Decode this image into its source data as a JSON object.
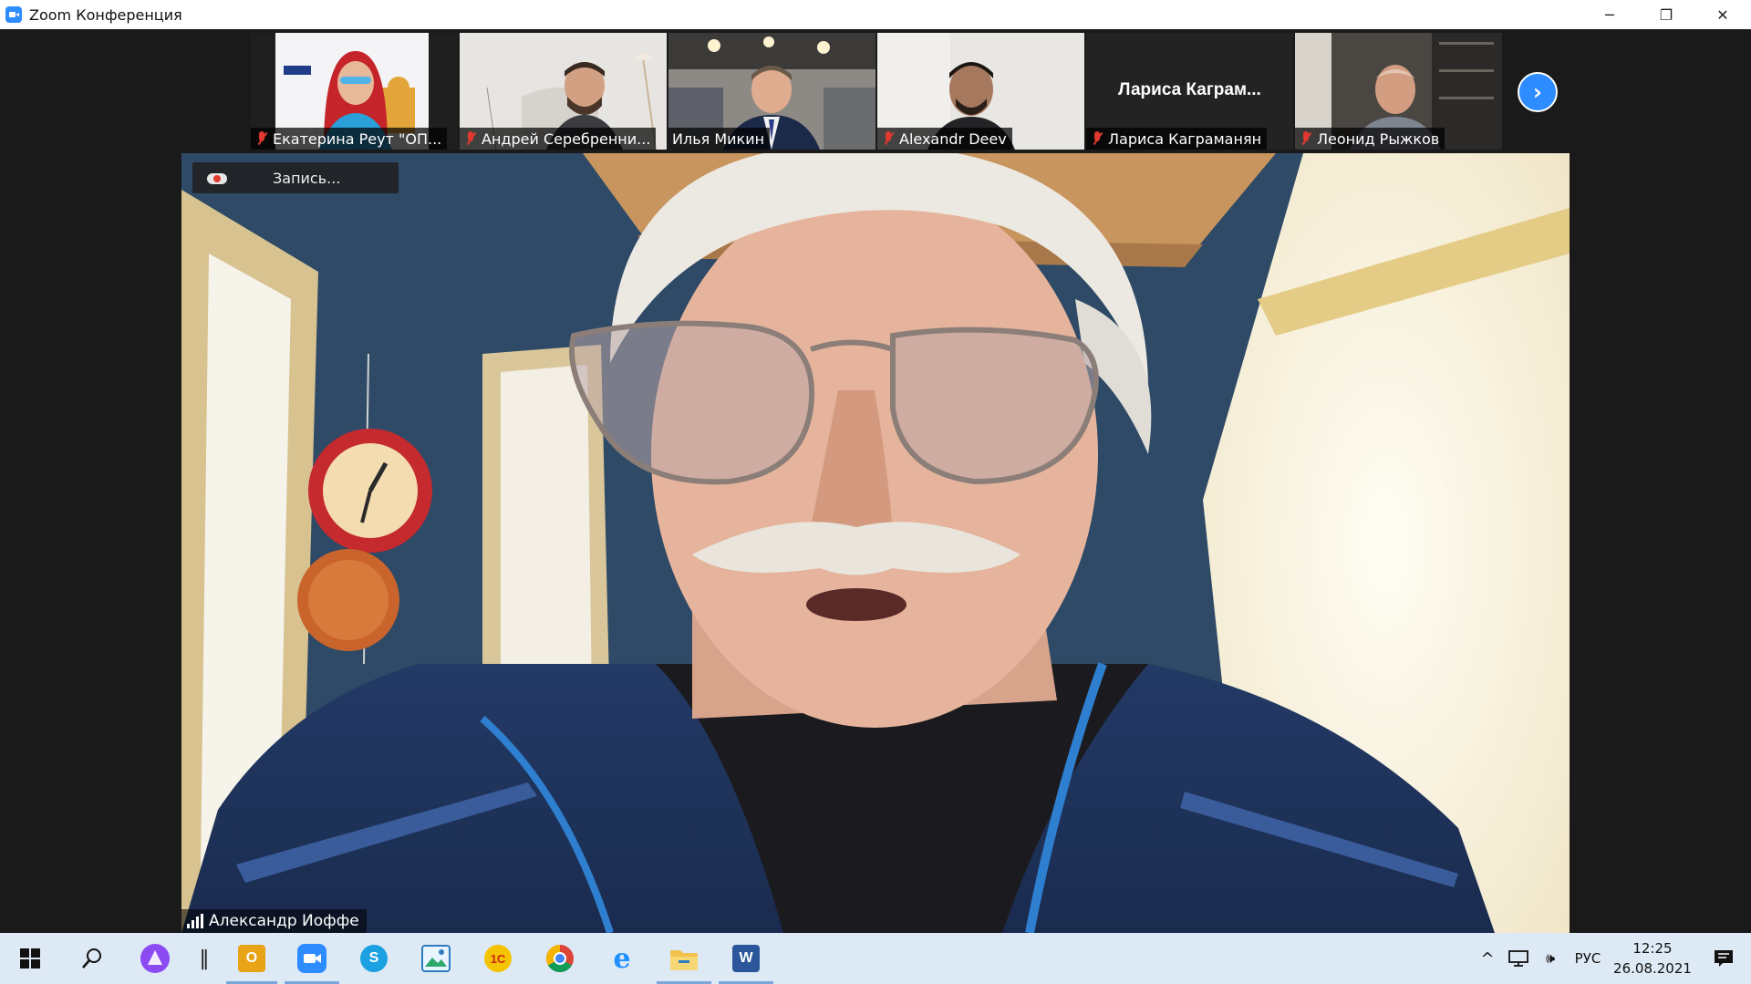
{
  "window": {
    "title": "Zoom Конференция",
    "minimize_glyph": "─",
    "restore_glyph": "❐",
    "close_glyph": "✕"
  },
  "participants": [
    {
      "name": "Екатерина Реут \"ОП...",
      "muted": true,
      "kind": "video-woman"
    },
    {
      "name": "Андрей Серебренни...",
      "muted": true,
      "kind": "video-man-light"
    },
    {
      "name": "Илья Микин",
      "muted": false,
      "kind": "video-man-office"
    },
    {
      "name": "Alexandr Deev",
      "muted": true,
      "kind": "video-man-plain"
    },
    {
      "name": "Лариса Каграманян",
      "muted": true,
      "kind": "name-only",
      "display_name": "Лариса  Каграм..."
    },
    {
      "name": "Леонид Рыжков",
      "muted": true,
      "kind": "video-man-room"
    }
  ],
  "next_page_glyph": "›",
  "main_video": {
    "recording_label": "Запись...",
    "speaker_name": "Александр Иоффе"
  },
  "taskbar": {
    "items": [
      {
        "id": "start",
        "icon": "windows-start-icon"
      },
      {
        "id": "search",
        "icon": "search-icon",
        "glyph": "⚲"
      },
      {
        "id": "alice",
        "icon": "alice-assistant-icon"
      },
      {
        "id": "separator",
        "icon": "taskview-separator-icon",
        "glyph": "‖"
      },
      {
        "id": "outlook",
        "icon": "outlook-icon",
        "glyph": "O",
        "color": "#e8a317",
        "active": true
      },
      {
        "id": "zoom",
        "icon": "zoom-icon",
        "color": "#2d8cff",
        "active": true
      },
      {
        "id": "skype",
        "icon": "skype-icon",
        "glyph": "S",
        "color": "#1ba1e2"
      },
      {
        "id": "photos",
        "icon": "photos-icon",
        "color": "#2ea86a"
      },
      {
        "id": "onec",
        "icon": "1c-icon",
        "glyph": "1С",
        "color": "#f5c400"
      },
      {
        "id": "chrome",
        "icon": "chrome-icon"
      },
      {
        "id": "ie",
        "icon": "internet-explorer-icon",
        "glyph": "e",
        "color": "#1e90ff"
      },
      {
        "id": "explorer",
        "icon": "file-explorer-icon",
        "color": "#f2c14e",
        "active": true
      },
      {
        "id": "word",
        "icon": "word-icon",
        "glyph": "W",
        "color": "#2b579a",
        "active": true
      }
    ],
    "tray": {
      "chevron_glyph": "^",
      "volume_glyph": "🕪",
      "language": "РУС",
      "time": "12:25",
      "date": "26.08.2021"
    }
  },
  "colors": {
    "zoom_blue": "#2d8cff",
    "muted_red": "#e0392f",
    "taskbar_bg": "#dde9f5"
  }
}
